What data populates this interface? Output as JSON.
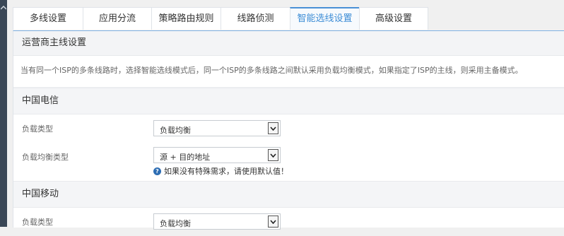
{
  "tabs": [
    {
      "label": "多线设置",
      "active": false
    },
    {
      "label": "应用分流",
      "active": false
    },
    {
      "label": "策略路由规则",
      "active": false
    },
    {
      "label": "线路侦测",
      "active": false
    },
    {
      "label": "智能选线设置",
      "active": true
    },
    {
      "label": "高级设置",
      "active": false
    }
  ],
  "section": {
    "title": "运营商主线设置",
    "description": "当有同一个ISP的多条线路时，选择智能选线模式后，同一个ISP的多条线路之间默认采用负载均衡模式，如果指定了ISP的主线，则采用主备模式。"
  },
  "groups": [
    {
      "title": "中国电信",
      "load_type_label": "负载类型",
      "load_type_value": "负载均衡",
      "balance_type_label": "负载均衡类型",
      "balance_type_value": "源 + 目的地址",
      "hint": "如果没有特殊需求，请使用默认值！"
    },
    {
      "title": "中国移动",
      "load_type_label": "负载类型",
      "load_type_value": "负载均衡"
    }
  ],
  "icons": {
    "sidebar_toggle": "chevron-up-icon",
    "help": "question-circle-icon"
  },
  "colors": {
    "active_tab_text": "#3d8dd6",
    "help_icon": "#2d6db3",
    "sidebar": "#3a4756"
  }
}
